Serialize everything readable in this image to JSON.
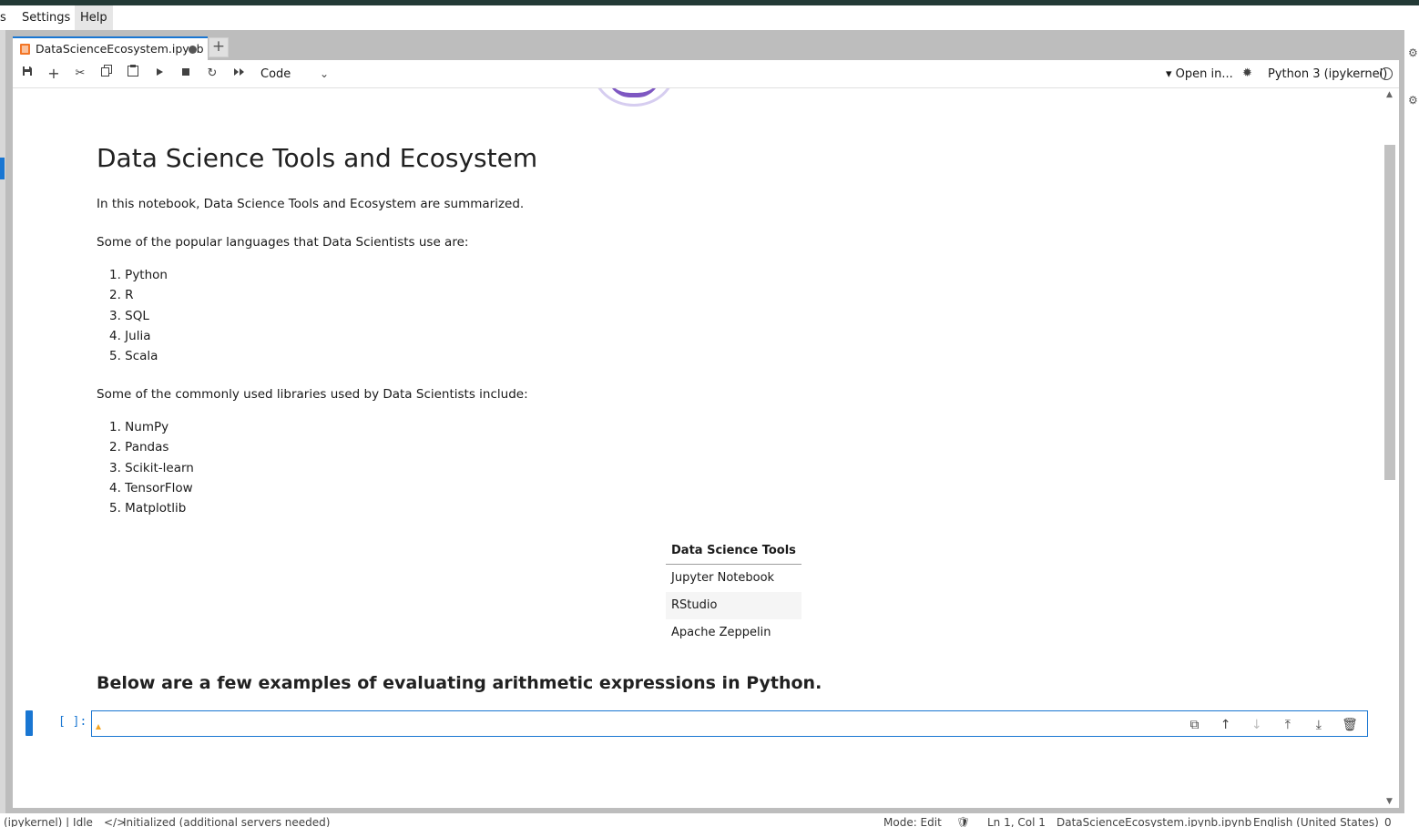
{
  "menubar": {
    "items": [
      "s",
      "Settings",
      "Help"
    ]
  },
  "tab": {
    "title": "DataScienceEcosystem.ipynb",
    "new_tab_label": "+"
  },
  "toolbar": {
    "cell_type": "Code",
    "open_in": "Open in...",
    "kernel_name": "Python 3 (ipykernel)"
  },
  "notebook": {
    "title": "Data Science Tools and Ecosystem",
    "intro": "In this notebook, Data Science Tools and Ecosystem are summarized.",
    "languages_intro": "Some of the popular languages that Data Scientists use are:",
    "languages": [
      "1. Python",
      "2. R",
      "3. SQL",
      "4. Julia",
      "5. Scala"
    ],
    "libraries_intro": "Some of the commonly used libraries used by Data Scientists include:",
    "libraries": [
      "1. NumPy",
      "2. Pandas",
      "3. Scikit-learn",
      "4. TensorFlow",
      "5. Matplotlib"
    ],
    "tools_table": {
      "header": "Data Science Tools",
      "rows": [
        "Jupyter Notebook",
        "RStudio",
        "Apache Zeppelin"
      ]
    },
    "arithmetic_heading": "Below are a few examples of evaluating arithmetic expressions in Python.",
    "code_cell": {
      "prompt": "[ ]:",
      "source": ""
    }
  },
  "statusbar": {
    "kernel_status": "(ipykernel) | Idle",
    "lsp_status": "Initialized (additional servers needed)",
    "mode": "Mode: Edit",
    "cursor": "Ln 1, Col 1",
    "file": "DataScienceEcosystem.ipynb.ipynb",
    "language": "English (United States)",
    "notifications": "0"
  },
  "colors": {
    "accent": "#1976d2",
    "topbar": "#233a36",
    "notebook_icon": "#f37626"
  }
}
